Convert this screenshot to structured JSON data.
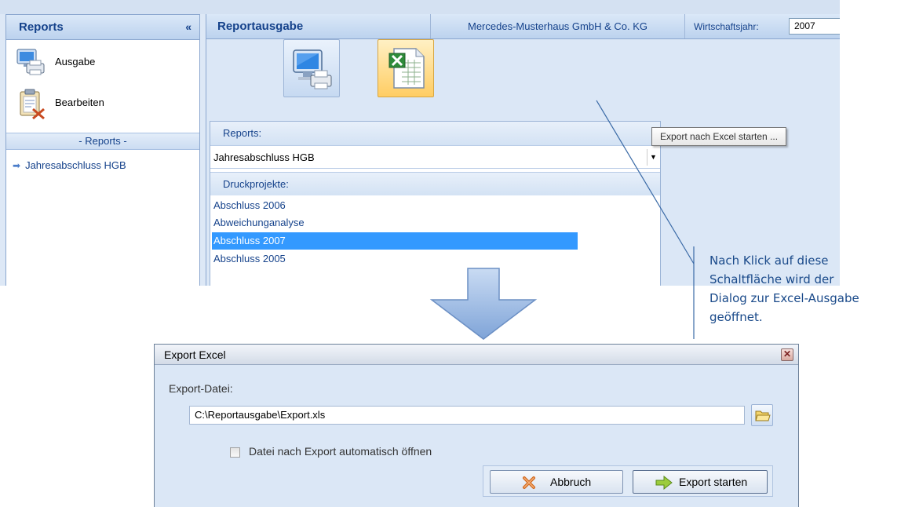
{
  "sidebar": {
    "title": "Reports",
    "collapse_glyph": "«",
    "items": [
      {
        "label": "Ausgabe",
        "icon": "computer-printer-icon"
      },
      {
        "label": "Bearbeiten",
        "icon": "clipboard-edit-icon"
      }
    ],
    "section_label": "- Reports -",
    "tree_items": [
      {
        "label": "Jahresabschluss HGB",
        "icon": "arrow-right-icon"
      }
    ]
  },
  "main": {
    "title": "Reportausgabe",
    "company": "Mercedes-Musterhaus GmbH & Co. KG",
    "fiscal_year_label": "Wirtschaftsjahr:",
    "fiscal_year_value": "2007",
    "toolbar": {
      "print_icon": "computer-printer-icon",
      "excel_icon": "excel-sheet-icon"
    },
    "tooltip": "Export nach Excel starten ...",
    "reports_label": "Reports:",
    "reports_selected": "Jahresabschluss HGB",
    "druckprojekte_label": "Druckprojekte:",
    "druckprojekte": [
      {
        "label": "Abschluss 2006",
        "selected": false
      },
      {
        "label": "Abweichunganalyse",
        "selected": false
      },
      {
        "label": "Abschluss 2007",
        "selected": true
      },
      {
        "label": "Abschluss 2005",
        "selected": false
      }
    ]
  },
  "callout": {
    "lines": [
      "Nach Klick auf diese",
      "Schaltfläche wird der",
      "Dialog zur Excel-Ausgabe",
      "geöffnet."
    ]
  },
  "dialog": {
    "title": "Export Excel",
    "close_glyph": "✕",
    "file_label": "Export-Datei:",
    "file_path": "C:\\Reportausgabe\\Export.xls",
    "auto_open_label": "Datei nach Export automatisch öffnen",
    "auto_open_checked": false,
    "cancel_label": "Abbruch",
    "export_label": "Export starten"
  },
  "colors": {
    "accent": "#15428b",
    "selection": "#3399ff",
    "panel_bg": "#dbe7f6",
    "excel_button": "#ffcd63",
    "arrow": "#8fb1de"
  }
}
